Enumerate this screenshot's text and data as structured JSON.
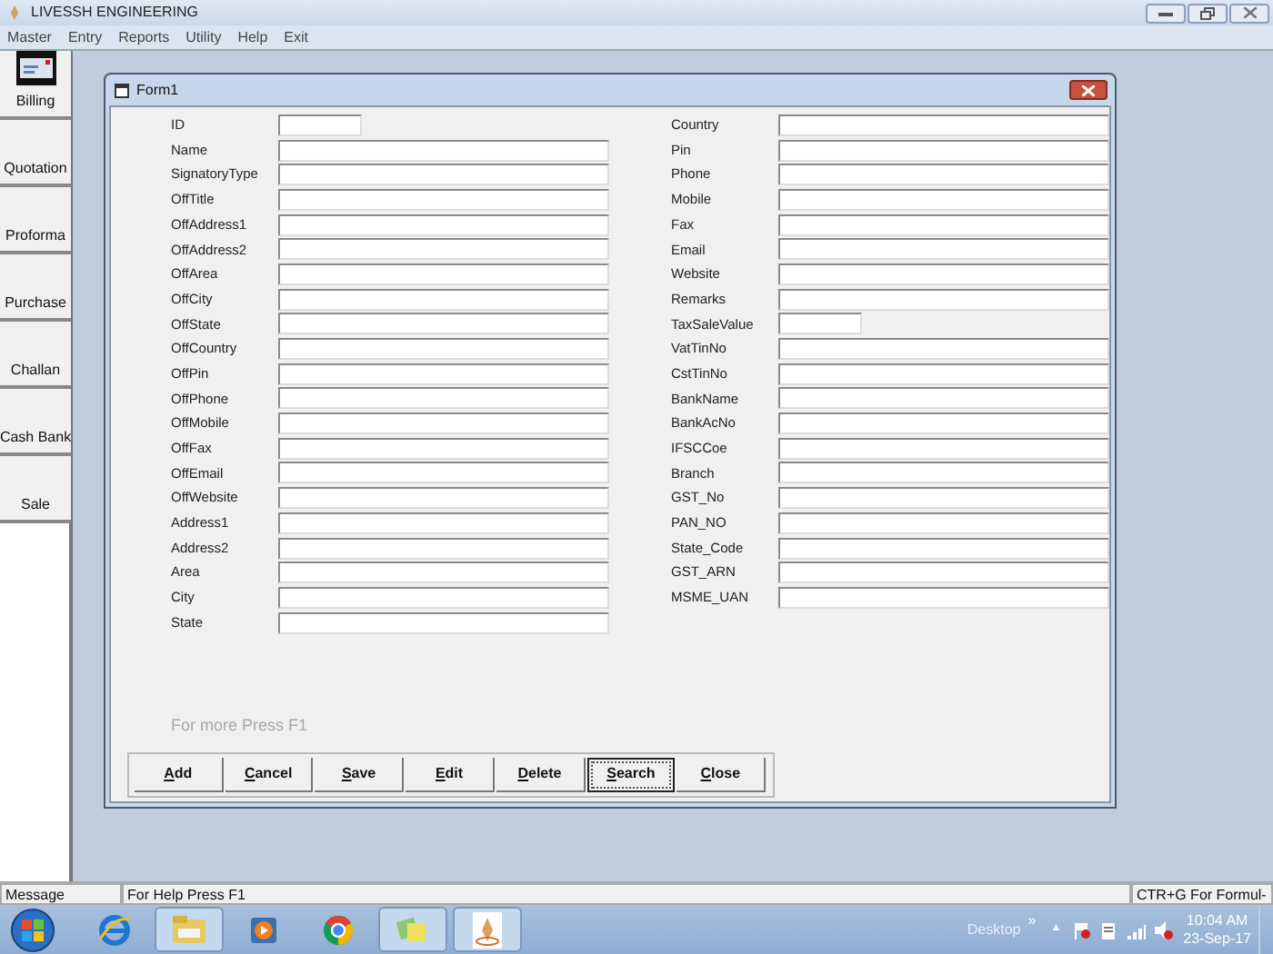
{
  "app": {
    "title": "LIVESSH ENGINEERING"
  },
  "menu": [
    "Master",
    "Entry",
    "Reports",
    "Utility",
    "Help",
    "Exit"
  ],
  "sidebar": [
    {
      "label": "Billing",
      "kind": "icon"
    },
    {
      "label": "Quotation",
      "kind": "text"
    },
    {
      "label": "Proforma",
      "kind": "text"
    },
    {
      "label": "Purchase",
      "kind": "text"
    },
    {
      "label": "Challan",
      "kind": "text"
    },
    {
      "label": "Cash Bank",
      "kind": "text"
    },
    {
      "label": "Sale",
      "kind": "text"
    }
  ],
  "form": {
    "title": "Form1",
    "left_fields": [
      {
        "label": "ID",
        "kind": "short"
      },
      {
        "label": "Name",
        "kind": "wide"
      },
      {
        "label": "SignatoryType",
        "kind": "wide"
      },
      {
        "label": "OffTitle",
        "kind": "wide"
      },
      {
        "label": "OffAddress1",
        "kind": "wide"
      },
      {
        "label": "OffAddress2",
        "kind": "wide"
      },
      {
        "label": "OffArea",
        "kind": "wide"
      },
      {
        "label": "OffCity",
        "kind": "wide"
      },
      {
        "label": "OffState",
        "kind": "wide"
      },
      {
        "label": "OffCountry",
        "kind": "wide"
      },
      {
        "label": "OffPin",
        "kind": "wide"
      },
      {
        "label": "OffPhone",
        "kind": "wide"
      },
      {
        "label": "OffMobile",
        "kind": "wide"
      },
      {
        "label": "OffFax",
        "kind": "wide"
      },
      {
        "label": "OffEmail",
        "kind": "wide"
      },
      {
        "label": "OffWebsite",
        "kind": "wide"
      },
      {
        "label": "Address1",
        "kind": "wide"
      },
      {
        "label": "Address2",
        "kind": "wide"
      },
      {
        "label": "Area",
        "kind": "wide"
      },
      {
        "label": "City",
        "kind": "wide"
      },
      {
        "label": "State",
        "kind": "wide"
      }
    ],
    "right_fields": [
      {
        "label": "Country",
        "kind": "wide"
      },
      {
        "label": "Pin",
        "kind": "wide"
      },
      {
        "label": "Phone",
        "kind": "wide"
      },
      {
        "label": "Mobile",
        "kind": "wide"
      },
      {
        "label": "Fax",
        "kind": "wide"
      },
      {
        "label": "Email",
        "kind": "wide"
      },
      {
        "label": "Website",
        "kind": "wide"
      },
      {
        "label": "Remarks",
        "kind": "wide"
      },
      {
        "label": "TaxSaleValue",
        "kind": "short"
      },
      {
        "label": "VatTinNo",
        "kind": "wide"
      },
      {
        "label": "CstTinNo",
        "kind": "wide"
      },
      {
        "label": "BankName",
        "kind": "wide"
      },
      {
        "label": "BankAcNo",
        "kind": "wide"
      },
      {
        "label": "IFSCCoe",
        "kind": "wide"
      },
      {
        "label": "Branch",
        "kind": "wide"
      },
      {
        "label": "GST_No",
        "kind": "wide"
      },
      {
        "label": "PAN_NO",
        "kind": "wide"
      },
      {
        "label": "State_Code",
        "kind": "wide"
      },
      {
        "label": "GST_ARN",
        "kind": "wide"
      },
      {
        "label": "MSME_UAN",
        "kind": "wide"
      }
    ],
    "hint": "For more Press F1",
    "buttons": [
      {
        "label": "Add",
        "focused": false
      },
      {
        "label": "Cancel",
        "focused": false
      },
      {
        "label": "Save",
        "focused": false
      },
      {
        "label": "Edit",
        "focused": false
      },
      {
        "label": "Delete",
        "focused": false
      },
      {
        "label": "Search",
        "focused": true
      },
      {
        "label": "Close",
        "focused": false
      }
    ]
  },
  "status_bar": [
    "Message",
    "For Help Press F1",
    "CTR+G For Formul-"
  ],
  "taskbar": {
    "apps": [
      {
        "kind": "ie",
        "active": false
      },
      {
        "kind": "folder",
        "active": true
      },
      {
        "kind": "media",
        "active": false
      },
      {
        "kind": "chrome",
        "active": false
      },
      {
        "kind": "notes",
        "active": true
      },
      {
        "kind": "app",
        "active": true
      }
    ],
    "desktop": "Desktop",
    "chevron": "»",
    "arrow": "▲",
    "time": "10:04 AM",
    "date": "23-Sep-17"
  }
}
